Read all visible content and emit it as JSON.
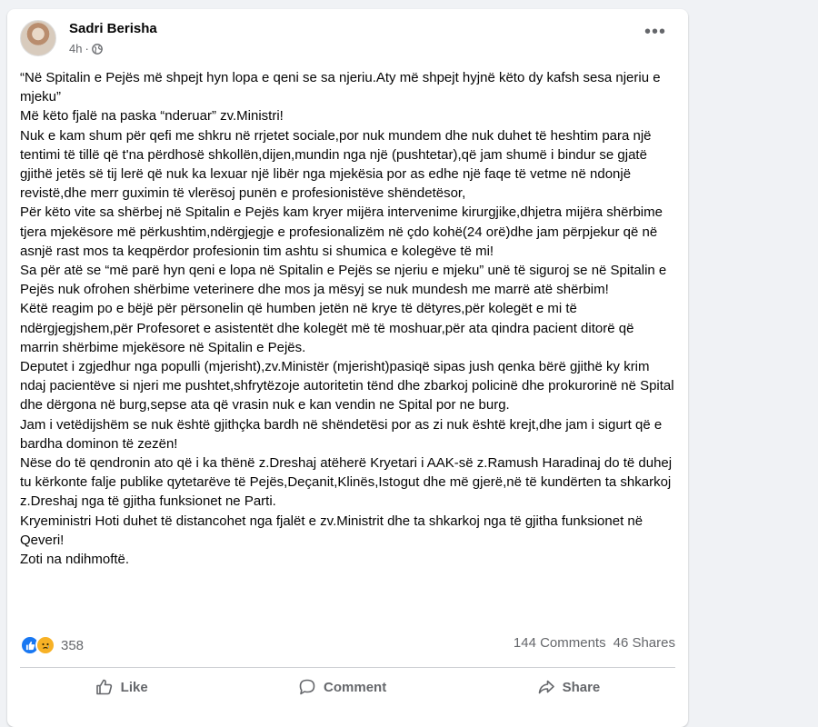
{
  "post": {
    "author": "Sadri Berisha",
    "time": "4h",
    "dot": "·",
    "more": "•••",
    "paragraphs": [
      "“Në Spitalin e Pejës më shpejt hyn lopa e qeni se sa njeriu.Aty më shpejt hyjnë këto dy kafsh sesa njeriu e mjeku”",
      "Më këto fjalë na paska “nderuar” zv.Ministri!",
      "Nuk e kam shum për qefi me shkru në rrjetet sociale,por nuk mundem dhe nuk duhet të heshtim para një tentimi të tillë që t'na përdhosë shkollën,dijen,mundin nga një (pushtetar),që jam shumë i bindur se gjatë gjithë jetës së tij lerë që nuk ka lexuar një libër nga mjekësia por as edhe një faqe të vetme në ndonjë revistë,dhe merr guximin të vlerësoj punën e profesionistëve shëndetësor,",
      "Për këto vite sa shërbej në Spitalin e Pejës kam kryer mijëra intervenime kirurgjike,dhjetra mijëra shërbime tjera mjekësore më përkushtim,ndërgjegje e profesionalizëm në çdo kohë(24 orë)dhe jam përpjekur që në asnjë rast mos ta keqpërdor profesionin tim ashtu si shumica e kolegëve të mi!",
      "Sa për atë se “më parë hyn qeni e lopa në Spitalin e Pejës se njeriu e mjeku” unë të siguroj se në Spitalin e Pejës nuk ofrohen shërbime veterinere dhe mos ja mësyj se nuk mundesh me marrë atë shërbim!",
      "Këtë reagim po e bëjë për përsonelin që humben jetën në krye të dëtyres,për kolegët e mi të ndërgjegjshem,për Profesoret e asistentët dhe kolegët më të moshuar,për ata qindra pacient ditorë që marrin shërbime mjekësore në Spitalin e Pejës.",
      "Deputet i zgjedhur nga populli (mjerisht),zv.Ministër (mjerisht)pasiqë sipas jush qenka bërë gjithë ky krim ndaj pacientëve si njeri me pushtet,shfrytëzoje autoritetin tënd dhe zbarkoj policinë dhe prokurorinë në Spital dhe dërgona në burg,sepse ata që vrasin nuk e kan vendin ne Spital por ne burg.",
      "Jam i vetëdijshëm se nuk është gjithçka bardh në shëndetësi por as zi nuk është krejt,dhe jam i sigurt që e bardha dominon të zezën!",
      "Nëse do të qendronin ato që i ka thënë z.Dreshaj atëherë Kryetari i AAK-së z.Ramush Haradinaj do të duhej tu kërkonte falje publike qytetarëve të Pejës,Deçanit,Klinës,Istogut dhe më gjerë,në të kundërten ta shkarkoj z.Dreshaj nga të gjitha funksionet ne Parti.",
      "Kryeministri Hoti duhet të distancohet nga fjalët e zv.Ministrit dhe ta shkarkoj nga të gjitha funksionet në Qeveri!",
      "Zoti na ndihmoftë."
    ]
  },
  "stats": {
    "reactions": "358",
    "comments": "144 Comments",
    "shares": "46 Shares"
  },
  "actions": {
    "like": "Like",
    "comment": "Comment",
    "share": "Share"
  },
  "icons": {
    "privacy": "globe-icon",
    "like_reaction": "like-reaction-icon",
    "sad_reaction": "sad-reaction-icon",
    "like": "thumbs-up-icon",
    "comment": "speech-bubble-icon",
    "share": "share-arrow-icon"
  },
  "colors": {
    "like_blue": "#1877f2",
    "sad_yellow": "#f7b125",
    "secondary_text": "#65676b"
  }
}
